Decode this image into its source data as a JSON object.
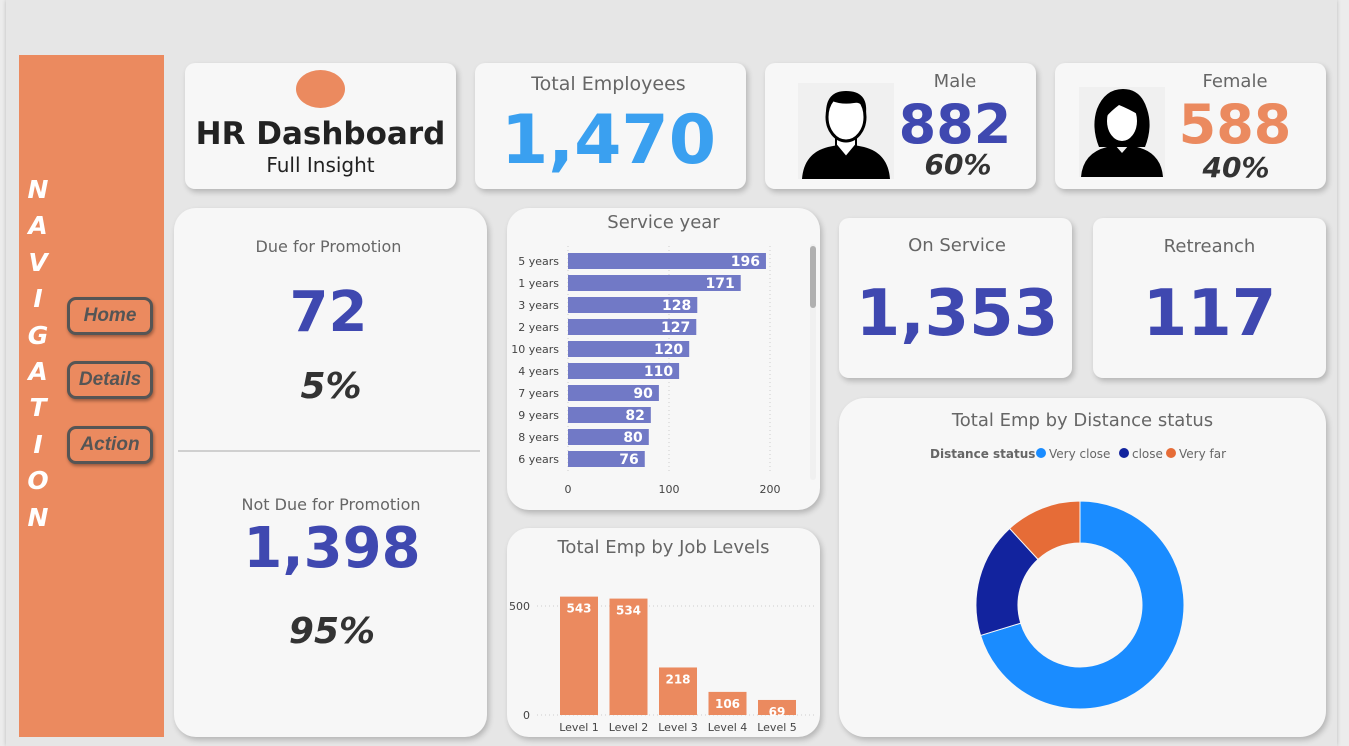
{
  "nav": {
    "title_letters": [
      "N",
      "A",
      "V",
      "I",
      "G",
      "A",
      "T",
      "I",
      "O",
      "N"
    ],
    "buttons": [
      "Home",
      "Details",
      "Action"
    ]
  },
  "title_card": {
    "title": "HR Dashboard",
    "subtitle": "Full Insight"
  },
  "total_employees": {
    "label": "Total Employees",
    "value": "1,470"
  },
  "male": {
    "label": "Male",
    "value": "882",
    "pct": "60%"
  },
  "female": {
    "label": "Female",
    "value": "588",
    "pct": "40%"
  },
  "promotion": {
    "due_label": "Due for Promotion",
    "due_value": "72",
    "due_pct": "5%",
    "not_due_label": "Not Due for Promotion",
    "not_due_value": "1,398",
    "not_due_pct": "95%"
  },
  "on_service": {
    "label": "On Service",
    "value": "1,353"
  },
  "retrench": {
    "label": "Retreanch",
    "value": "117"
  },
  "colors": {
    "accent": "#eb8a5f",
    "kpi_blue": "#3f48b0",
    "total_blue": "#3aa0f0",
    "bar": "#7179c6"
  },
  "chart_data": [
    {
      "type": "bar",
      "orientation": "horizontal",
      "title": "Service year",
      "categories": [
        "5 years",
        "1 years",
        "3 years",
        "2 years",
        "10 years",
        "4 years",
        "7 years",
        "9 years",
        "8 years",
        "6 years"
      ],
      "values": [
        196,
        171,
        128,
        127,
        120,
        110,
        90,
        82,
        80,
        76
      ],
      "xticks": [
        "0",
        "100",
        "200"
      ],
      "xlim": [
        0,
        212
      ]
    },
    {
      "type": "bar",
      "title": "Total Emp by Job Levels",
      "categories": [
        "Level 1",
        "Level 2",
        "Level 3",
        "Level 4",
        "Level 5"
      ],
      "values": [
        543,
        534,
        218,
        106,
        69
      ],
      "yticks": [
        "0",
        "500"
      ],
      "ylim": [
        0,
        600
      ]
    },
    {
      "type": "pie",
      "donut": true,
      "title": "Total Emp by Distance status",
      "legend_title": "Distance status",
      "legend_position": "top",
      "labels": [
        "Very close",
        "close",
        "Very far"
      ],
      "values": [
        1033,
        263,
        174
      ],
      "colors": [
        "#1a8cff",
        "#12239e",
        "#e66c37"
      ]
    }
  ]
}
